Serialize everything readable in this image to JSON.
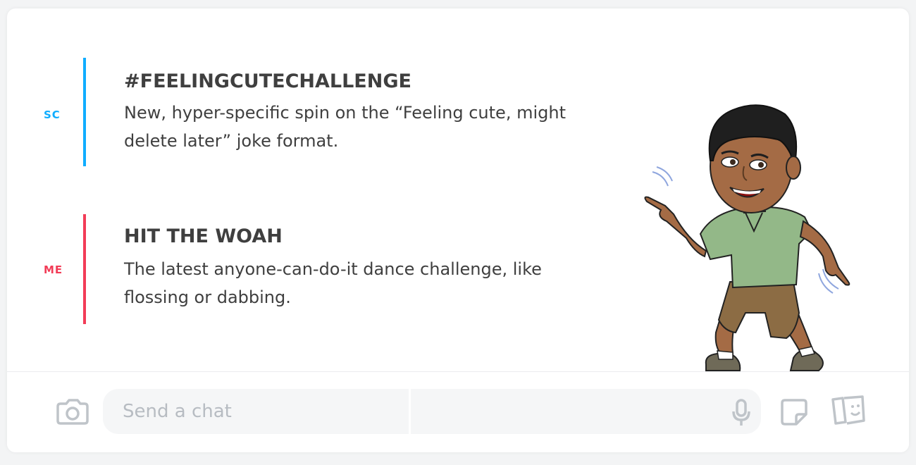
{
  "messages": [
    {
      "sender": "SC",
      "sender_color": "#0fadff",
      "title": "#FEELINGCUTECHALLENGE",
      "body": "New, hyper-specific spin on the “Feeling cute, might delete later” joke format."
    },
    {
      "sender": "ME",
      "sender_color": "#f23c57",
      "title": "HIT THE WOAH",
      "body": "The latest anyone-can-do-it dance challenge, like flossing or dabbing."
    }
  ],
  "composer": {
    "placeholder": "Send a chat",
    "value": ""
  },
  "icons": {
    "camera": "camera-icon",
    "microphone": "microphone-icon",
    "sticker": "sticker-icon",
    "bitmoji": "bitmoji-icon"
  },
  "colors": {
    "icon_gray": "#bfc4c9",
    "text": "#3f3f3f"
  }
}
